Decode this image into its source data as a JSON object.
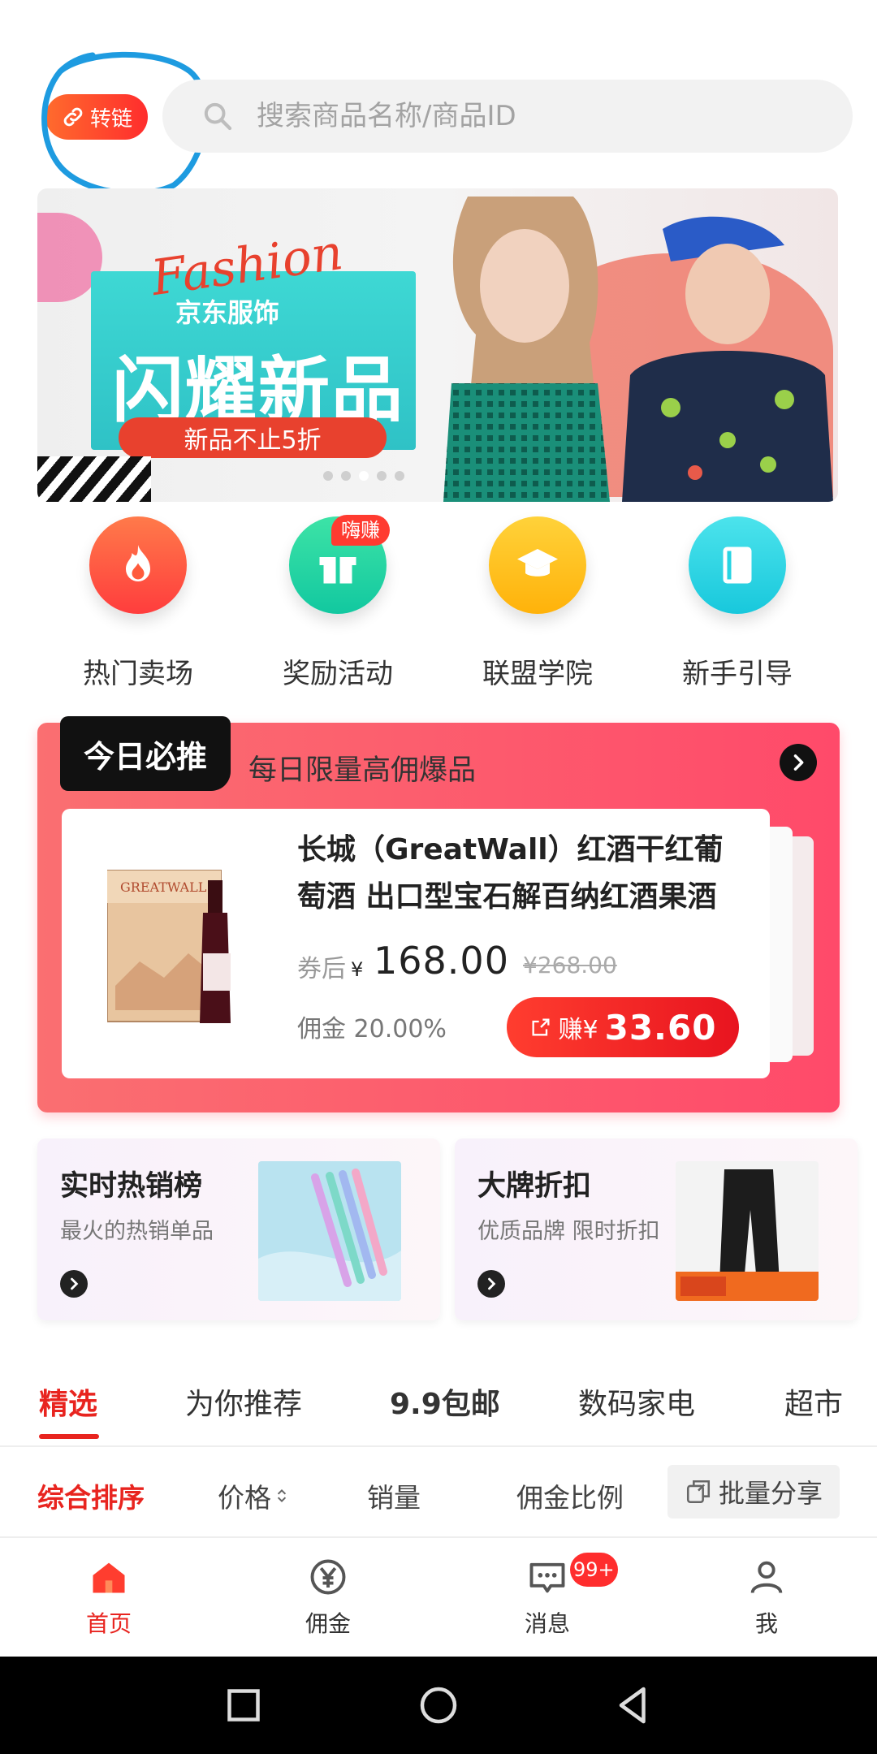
{
  "topbar": {
    "link_label": "转链",
    "search_placeholder": "搜索商品名称/商品ID"
  },
  "banner": {
    "script_text": "Fashion",
    "subtitle": "京东服饰",
    "title": "闪耀新品",
    "pill": "新品不止5折",
    "pager_count": 5,
    "pager_active": 3
  },
  "categories": [
    {
      "label": "热门卖场",
      "icon": "flame-icon",
      "color": "#ff5a3c"
    },
    {
      "label": "奖励活动",
      "icon": "gift-icon",
      "color": "#1fd3a3",
      "badge": "嗨赚"
    },
    {
      "label": "联盟学院",
      "icon": "graduation-cap-icon",
      "color": "#ffc21a"
    },
    {
      "label": "新手引导",
      "icon": "book-icon",
      "color": "#27d4e3"
    }
  ],
  "today": {
    "tag": "今日必推",
    "subtitle": "每日限量高佣爆品",
    "product": {
      "title": "长城（GreatWall）红酒干红葡萄酒 出口型宝石解百纳红酒果酒",
      "after_coupon_label": "券后",
      "currency": "¥",
      "price": "168.00",
      "old_price": "¥268.00",
      "commission": "佣金 20.00%",
      "earn_label": "赚¥",
      "earn_value": "33.60"
    }
  },
  "tiles": [
    {
      "title": "实时热销榜",
      "subtitle": "最火的热销单品"
    },
    {
      "title": "大牌折扣",
      "subtitle": "优质品牌 限时折扣"
    }
  ],
  "tabs": [
    "精选",
    "为你推荐",
    "9.9包邮",
    "数码家电",
    "超市"
  ],
  "sort": {
    "comprehensive": "综合排序",
    "price": "价格",
    "sales": "销量",
    "commission_rate": "佣金比例",
    "batch_share": "批量分享"
  },
  "bottom_nav": {
    "home": "首页",
    "commission": "佣金",
    "messages": "消息",
    "messages_badge": "99+",
    "me": "我"
  },
  "colors": {
    "accent": "#e8241f",
    "today_bg": "#ff5a6e",
    "search_bg": "#f2f2f2"
  }
}
